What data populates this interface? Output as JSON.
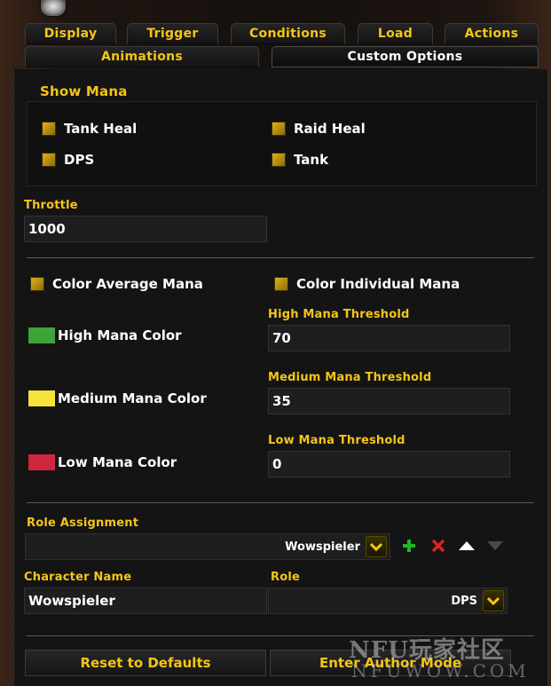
{
  "tabs_row1": [
    "Display",
    "Trigger",
    "Conditions",
    "Load",
    "Actions"
  ],
  "tabs_row2": [
    "Animations",
    "Custom Options"
  ],
  "show_mana": {
    "title": "Show Mana",
    "options": [
      "Tank Heal",
      "Raid Heal",
      "DPS",
      "Tank"
    ]
  },
  "throttle": {
    "label": "Throttle",
    "value": "1000"
  },
  "color_options": {
    "average": "Color Average Mana",
    "individual": "Color Individual Mana"
  },
  "thresholds": {
    "high": {
      "color_label": "High Mana Color",
      "color": "#3fa33a",
      "label": "High Mana Threshold",
      "value": "70"
    },
    "medium": {
      "color_label": "Medium Mana Color",
      "color": "#f5e33a",
      "label": "Medium Mana Threshold",
      "value": "35"
    },
    "low": {
      "color_label": "Low Mana Color",
      "color": "#d0263f",
      "label": "Low Mana Threshold",
      "value": "0"
    }
  },
  "role_assignment": {
    "label": "Role Assignment",
    "selected": "Wowspieler"
  },
  "character": {
    "name_label": "Character Name",
    "name_value": "Wowspieler",
    "role_label": "Role",
    "role_value": "DPS"
  },
  "buttons": {
    "reset": "Reset to Defaults",
    "author": "Enter Author Mode"
  },
  "watermark": {
    "line1": "NFU玩家社区",
    "line2": "NFUWOW.COM"
  },
  "colors": {
    "gold": "#f5c518",
    "add": "#22b822",
    "remove": "#e02020"
  },
  "icons": [
    "chevron-down-icon",
    "plus-icon",
    "x-icon",
    "arrow-up-icon",
    "arrow-down-icon"
  ]
}
